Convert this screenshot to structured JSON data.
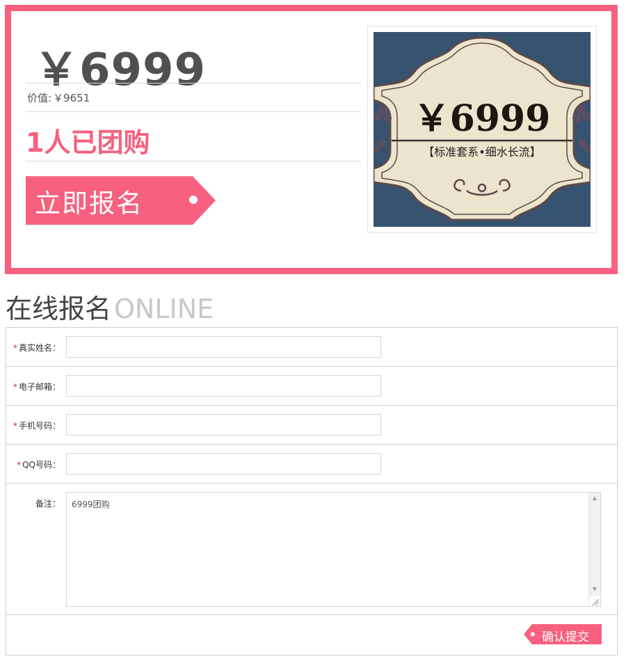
{
  "promo": {
    "price": "￥6999",
    "value_label": "价值:",
    "value_amount": "￥9651",
    "group_count_text": "1人已团购",
    "signup_button": "立即报名",
    "product_image": {
      "price_text": "￥6999",
      "subtitle": "【标准套系•细水长流】"
    }
  },
  "section": {
    "title_cn": "在线报名",
    "title_en": "ONLINE"
  },
  "form": {
    "required_mark": "*",
    "fields": {
      "name": {
        "label": "真实姓名：",
        "value": ""
      },
      "email": {
        "label": "电子邮箱：",
        "value": ""
      },
      "phone": {
        "label": "手机号码：",
        "value": ""
      },
      "qq": {
        "label": "QQ号码：",
        "value": ""
      }
    },
    "note": {
      "label": "备注：",
      "value": "6999团购"
    },
    "submit": "确认提交"
  },
  "colors": {
    "accent": "#f7607e",
    "frame": "#f7607e",
    "banner_bg": "#35526e",
    "banner_cream": "#ece4cc"
  }
}
